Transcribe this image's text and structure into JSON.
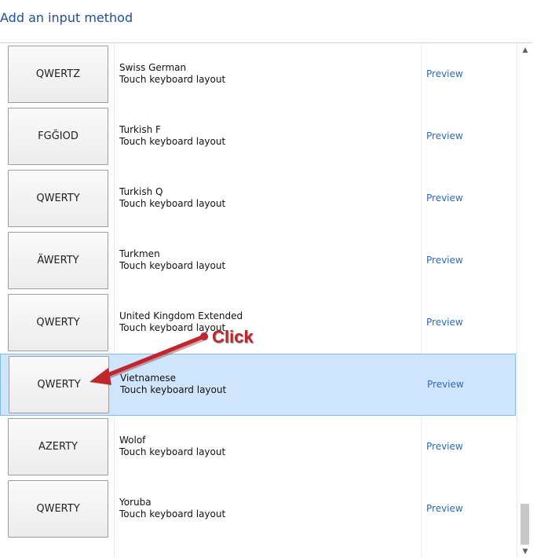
{
  "header": {
    "title": "Add an input method"
  },
  "rows": [
    {
      "key": "QWERTZ",
      "name": "Swiss German",
      "sub": "Touch keyboard layout",
      "action": "Preview"
    },
    {
      "key": "FGĞIOD",
      "name": "Turkish F",
      "sub": "Touch keyboard layout",
      "action": "Preview"
    },
    {
      "key": "QWERTY",
      "name": "Turkish Q",
      "sub": "Touch keyboard layout",
      "action": "Preview"
    },
    {
      "key": "ÄWERTY",
      "name": "Turkmen",
      "sub": "Touch keyboard layout",
      "action": "Preview"
    },
    {
      "key": "QWERTY",
      "name": "United Kingdom Extended",
      "sub": "Touch keyboard layout",
      "action": "Preview"
    },
    {
      "key": "QWERTY",
      "name": "Vietnamese",
      "sub": "Touch keyboard layout",
      "action": "Preview"
    },
    {
      "key": "AZERTY",
      "name": "Wolof",
      "sub": "Touch keyboard layout",
      "action": "Preview"
    },
    {
      "key": "QWERTY",
      "name": "Yoruba",
      "sub": "Touch keyboard layout",
      "action": "Preview"
    }
  ],
  "selected_row": 5,
  "annotation": {
    "label": "Click",
    "color": "#c0262b"
  },
  "scrollbar": {
    "up_icon": "chevron-up-icon",
    "down_icon": "chevron-down-icon"
  }
}
